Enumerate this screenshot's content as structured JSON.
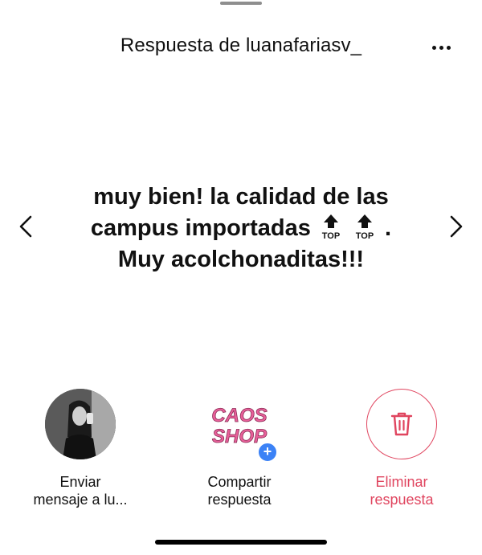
{
  "header": {
    "title": "Respuesta de luanafariasv_"
  },
  "reply": {
    "line1": "muy bien! la calidad de las",
    "line2_text": "campus importadas",
    "emoji_label": "TOP",
    "line2_end": ".",
    "line3": "Muy acolchonaditas!!!"
  },
  "actions": {
    "send": {
      "line1": "Enviar",
      "line2": "mensaje a lu..."
    },
    "share": {
      "line1": "Compartir",
      "line2": "respuesta",
      "logo_line1": "CAOS",
      "logo_line2": "SHOP"
    },
    "delete": {
      "line1": "Eliminar",
      "line2": "respuesta"
    }
  },
  "colors": {
    "accent_red": "#e0455f",
    "badge_blue": "#3b82f6",
    "logo_pink": "#e8609a"
  },
  "icons": {
    "more": "ellipsis-icon",
    "prev": "chevron-left-icon",
    "next": "chevron-right-icon",
    "delete": "trash-icon",
    "emoji": "top-arrow-emoji",
    "badge": "plus-icon"
  }
}
